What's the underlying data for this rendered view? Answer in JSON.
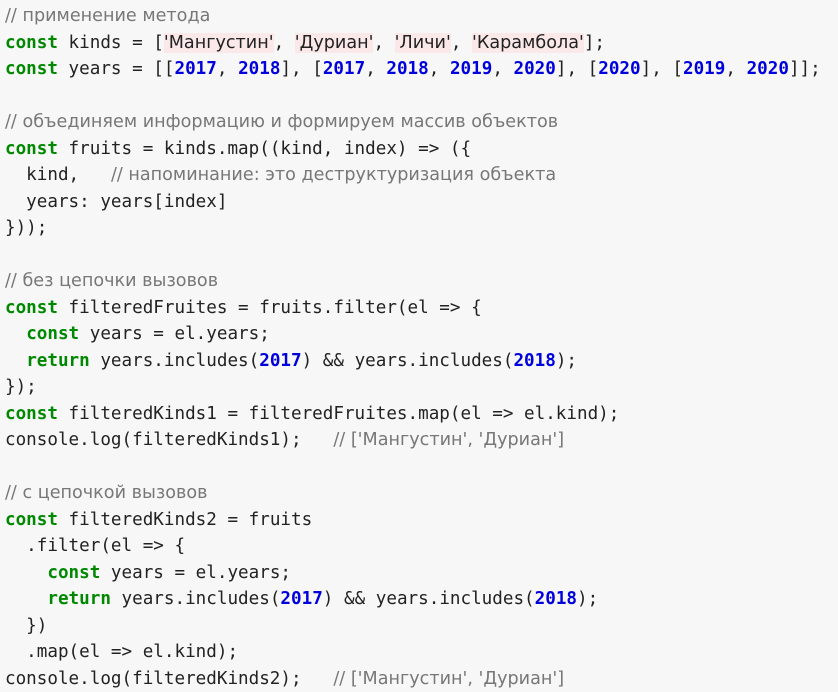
{
  "code_lines": [
    [
      {
        "t": "cmt",
        "v": "// применение метода"
      }
    ],
    [
      {
        "t": "kw",
        "v": "const"
      },
      {
        "t": "txt",
        "v": " kinds = ["
      },
      {
        "t": "str",
        "v": "'Мангустин'"
      },
      {
        "t": "txt",
        "v": ", "
      },
      {
        "t": "str",
        "v": "'Дуриан'"
      },
      {
        "t": "txt",
        "v": ", "
      },
      {
        "t": "str",
        "v": "'Личи'"
      },
      {
        "t": "txt",
        "v": ", "
      },
      {
        "t": "str",
        "v": "'Карамбола'"
      },
      {
        "t": "txt",
        "v": "];"
      }
    ],
    [
      {
        "t": "kw",
        "v": "const"
      },
      {
        "t": "txt",
        "v": " years = [["
      },
      {
        "t": "num",
        "v": "2017"
      },
      {
        "t": "txt",
        "v": ", "
      },
      {
        "t": "num",
        "v": "2018"
      },
      {
        "t": "txt",
        "v": "], ["
      },
      {
        "t": "num",
        "v": "2017"
      },
      {
        "t": "txt",
        "v": ", "
      },
      {
        "t": "num",
        "v": "2018"
      },
      {
        "t": "txt",
        "v": ", "
      },
      {
        "t": "num",
        "v": "2019"
      },
      {
        "t": "txt",
        "v": ", "
      },
      {
        "t": "num",
        "v": "2020"
      },
      {
        "t": "txt",
        "v": "], ["
      },
      {
        "t": "num",
        "v": "2020"
      },
      {
        "t": "txt",
        "v": "], ["
      },
      {
        "t": "num",
        "v": "2019"
      },
      {
        "t": "txt",
        "v": ", "
      },
      {
        "t": "num",
        "v": "2020"
      },
      {
        "t": "txt",
        "v": "]];"
      }
    ],
    [],
    [
      {
        "t": "cmt",
        "v": "// объединяем информацию и формируем массив объектов"
      }
    ],
    [
      {
        "t": "kw",
        "v": "const"
      },
      {
        "t": "txt",
        "v": " fruits = kinds.map((kind, index) => ({"
      }
    ],
    [
      {
        "t": "txt",
        "v": "  kind,   "
      },
      {
        "t": "cmt",
        "v": "// напоминание: это деструктуризация объекта"
      }
    ],
    [
      {
        "t": "txt",
        "v": "  years: years[index]"
      }
    ],
    [
      {
        "t": "txt",
        "v": "}));"
      }
    ],
    [],
    [
      {
        "t": "cmt",
        "v": "// без цепочки вызовов"
      }
    ],
    [
      {
        "t": "kw",
        "v": "const"
      },
      {
        "t": "txt",
        "v": " filteredFruites = fruits.filter(el => {"
      }
    ],
    [
      {
        "t": "txt",
        "v": "  "
      },
      {
        "t": "kw",
        "v": "const"
      },
      {
        "t": "txt",
        "v": " years = el.years;"
      }
    ],
    [
      {
        "t": "txt",
        "v": "  "
      },
      {
        "t": "kw",
        "v": "return"
      },
      {
        "t": "txt",
        "v": " years.includes("
      },
      {
        "t": "num",
        "v": "2017"
      },
      {
        "t": "txt",
        "v": ") && years.includes("
      },
      {
        "t": "num",
        "v": "2018"
      },
      {
        "t": "txt",
        "v": ");"
      }
    ],
    [
      {
        "t": "txt",
        "v": "});"
      }
    ],
    [
      {
        "t": "kw",
        "v": "const"
      },
      {
        "t": "txt",
        "v": " filteredKinds1 = filteredFruites.map(el => el.kind);"
      }
    ],
    [
      {
        "t": "txt",
        "v": "console.log(filteredKinds1);   "
      },
      {
        "t": "cmt",
        "v": "// ['Мангустин', 'Дуриан']"
      }
    ],
    [],
    [
      {
        "t": "cmt",
        "v": "// с цепочкой вызовов"
      }
    ],
    [
      {
        "t": "kw",
        "v": "const"
      },
      {
        "t": "txt",
        "v": " filteredKinds2 = fruits"
      }
    ],
    [
      {
        "t": "txt",
        "v": "  .filter(el => {"
      }
    ],
    [
      {
        "t": "txt",
        "v": "    "
      },
      {
        "t": "kw",
        "v": "const"
      },
      {
        "t": "txt",
        "v": " years = el.years;"
      }
    ],
    [
      {
        "t": "txt",
        "v": "    "
      },
      {
        "t": "kw",
        "v": "return"
      },
      {
        "t": "txt",
        "v": " years.includes("
      },
      {
        "t": "num",
        "v": "2017"
      },
      {
        "t": "txt",
        "v": ") && years.includes("
      },
      {
        "t": "num",
        "v": "2018"
      },
      {
        "t": "txt",
        "v": ");"
      }
    ],
    [
      {
        "t": "txt",
        "v": "  })"
      }
    ],
    [
      {
        "t": "txt",
        "v": "  .map(el => el.kind);"
      }
    ],
    [
      {
        "t": "txt",
        "v": "console.log(filteredKinds2);   "
      },
      {
        "t": "cmt",
        "v": "// ['Мангустин', 'Дуриан']"
      }
    ]
  ],
  "colors": {
    "background": "#f7f7f7",
    "keyword": "#008800",
    "number": "#0000dd",
    "comment": "#777777",
    "string_bg": "#fbe9e9",
    "text": "#222222"
  }
}
